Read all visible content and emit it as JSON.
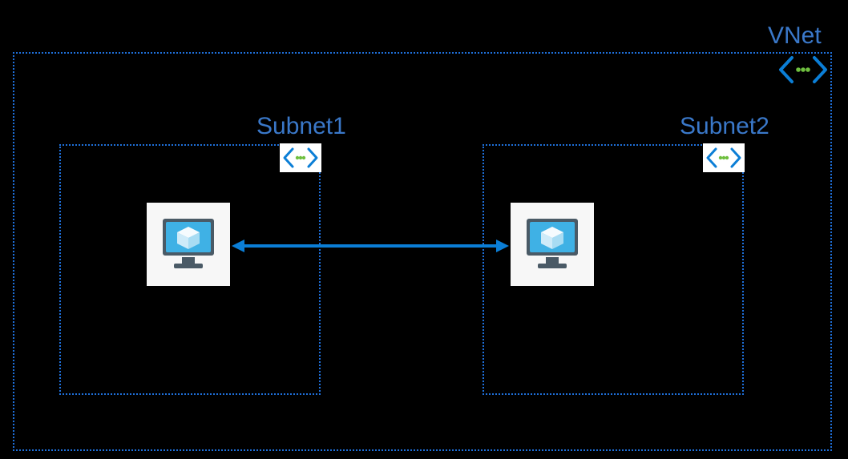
{
  "diagram": {
    "vnet_label": "VNet",
    "subnets": [
      {
        "label": "Subnet1"
      },
      {
        "label": "Subnet2"
      }
    ],
    "icon_names": {
      "vnet_icon": "vnet-icon",
      "subnet_icon": "subnet-icon",
      "vm_icon": "virtual-machine-icon"
    },
    "colors": {
      "border": "#1e6fd9",
      "label": "#3a78c9",
      "arrow": "#0b7ed6",
      "vm_screen": "#3fb1e5",
      "vm_body": "#4a5a66",
      "icon_blue": "#0b7ed6",
      "icon_dot": "#6fbf3f"
    }
  }
}
